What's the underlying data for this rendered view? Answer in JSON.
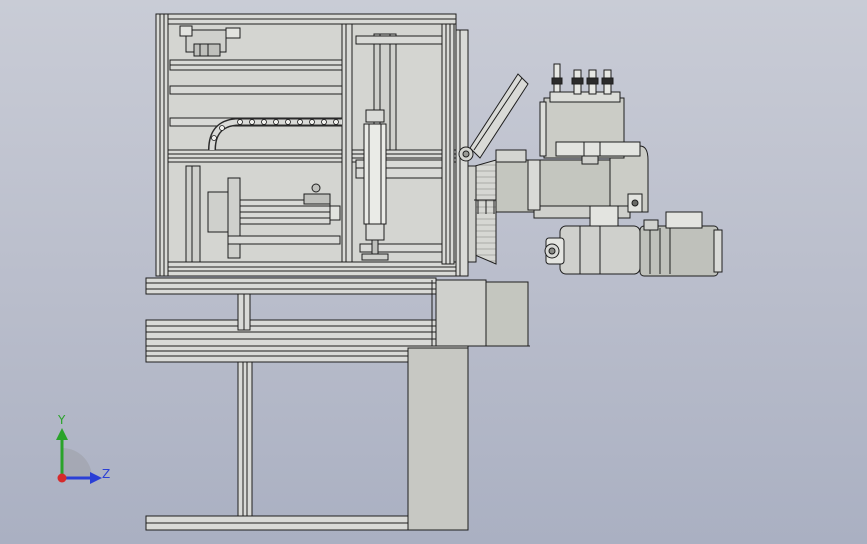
{
  "viewport": {
    "background_top": "#c9ccd6",
    "background_bottom": "#aab0c2"
  },
  "model": {
    "frame_color": "#d9dad7",
    "panel_color": "#cfd0cc",
    "housing_color": "#c4c6bf",
    "edge_color": "#1e1e1e"
  },
  "triad": {
    "y_label": "Y",
    "z_label": "Z",
    "y_color": "#2aa32a",
    "z_color": "#2a3fd6",
    "origin_color": "#d62a2a",
    "icons": [
      "y-axis-arrow-icon",
      "z-axis-arrow-icon",
      "origin-dot-icon"
    ]
  }
}
